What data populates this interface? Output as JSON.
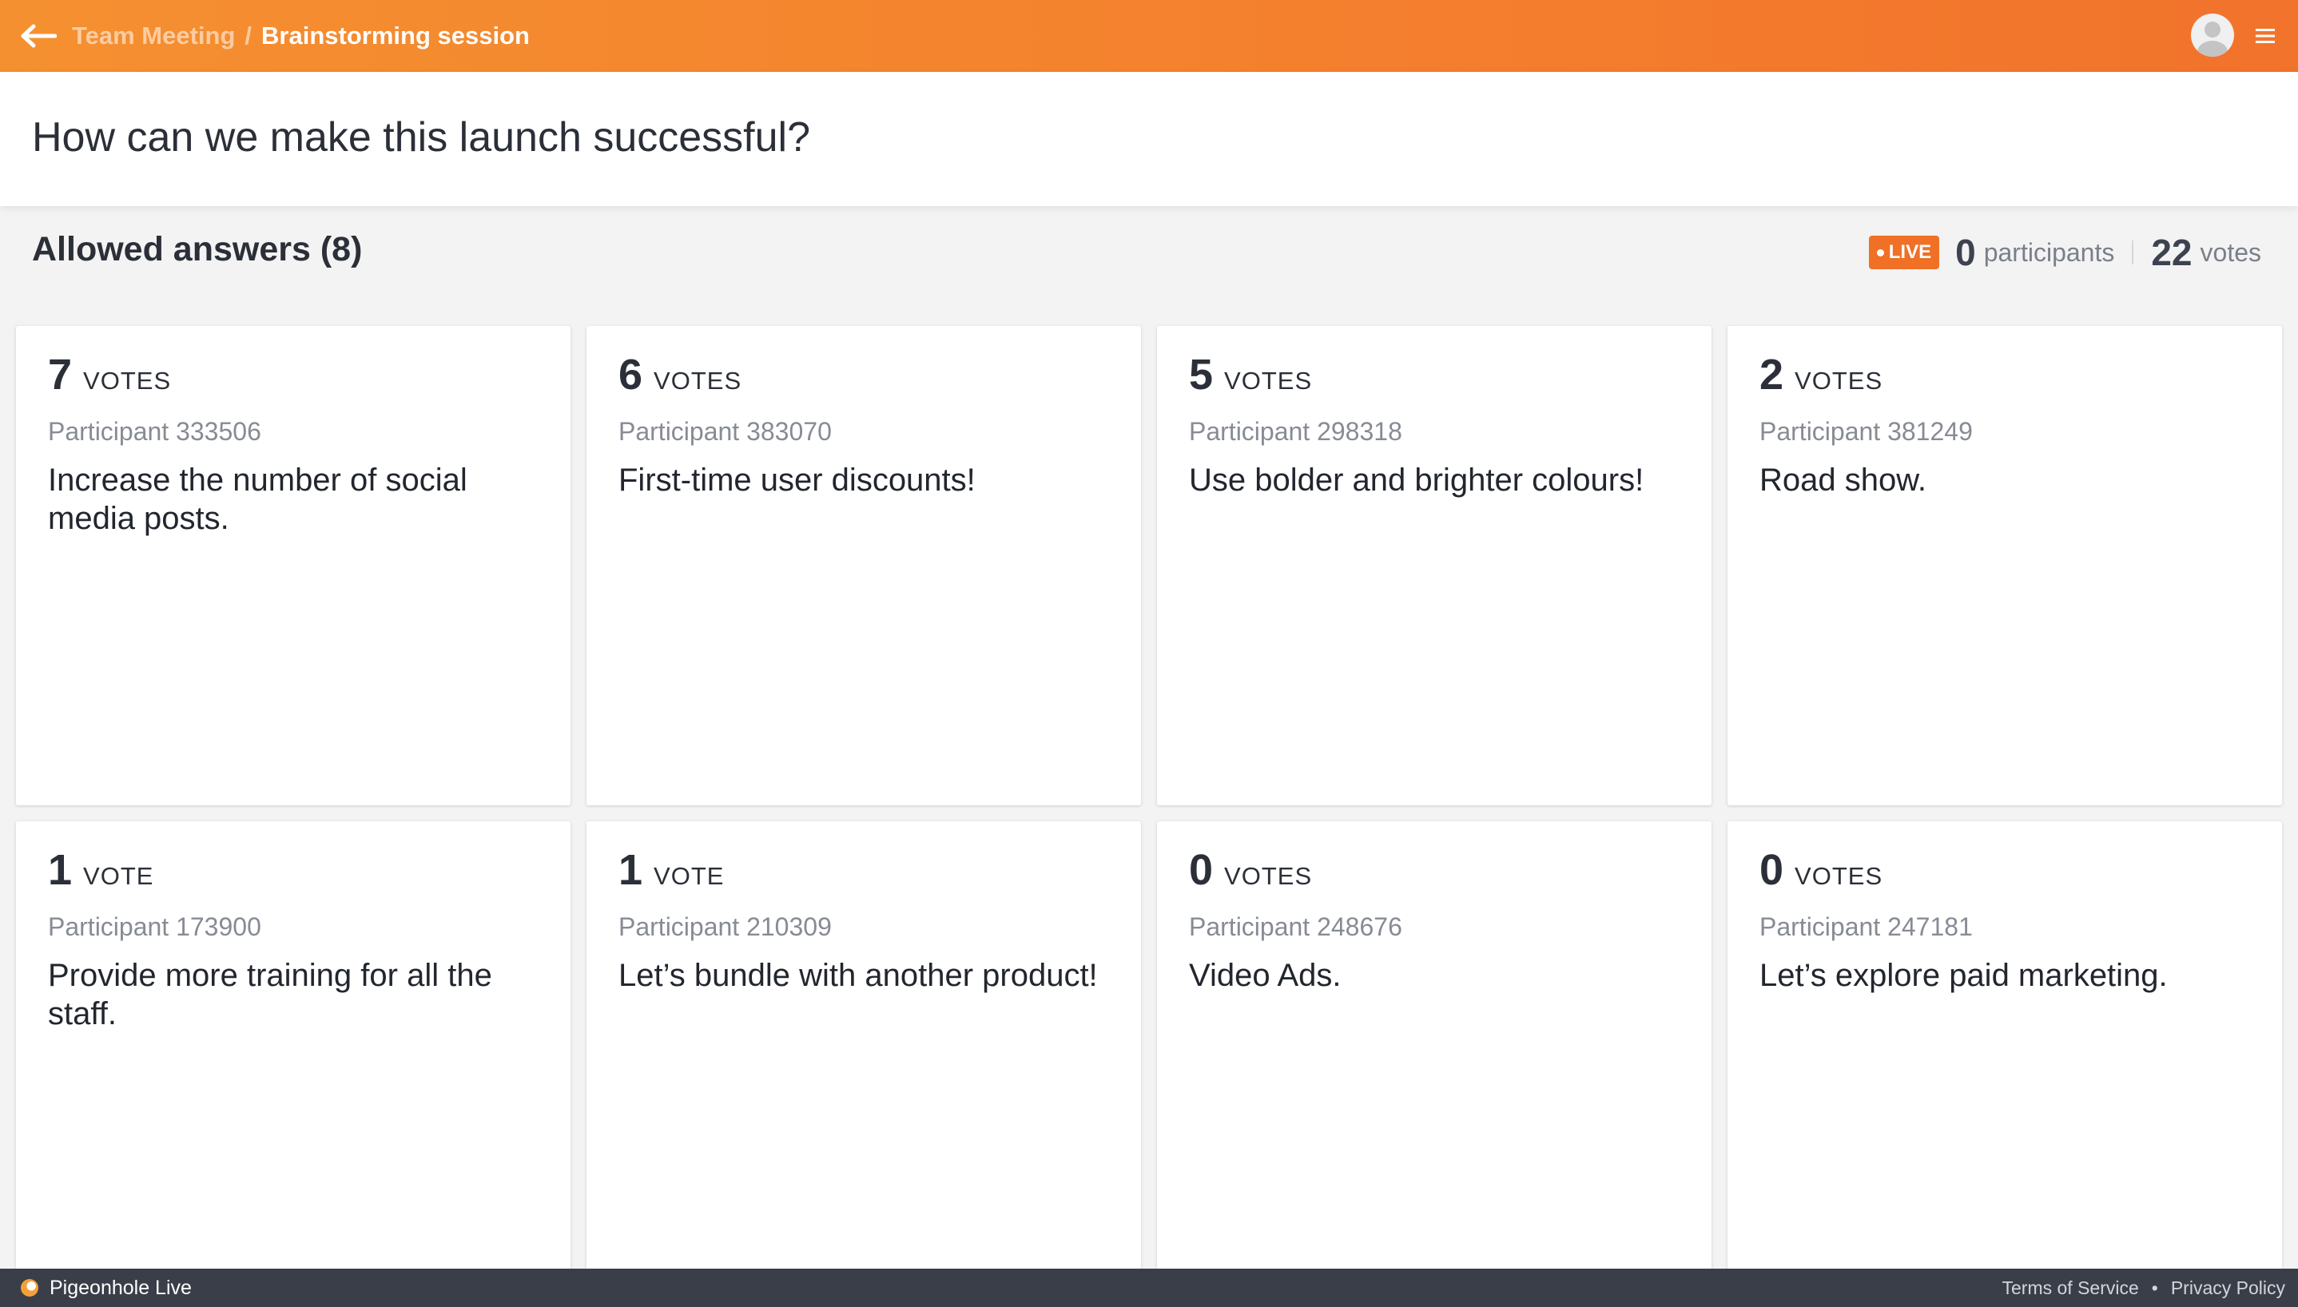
{
  "header": {
    "breadcrumb_parent": "Team Meeting",
    "breadcrumb_separator": "/",
    "breadcrumb_current": "Brainstorming session",
    "back_icon": "arrow-left-icon",
    "avatar_icon": "user-avatar-icon",
    "menu_icon": "hamburger-menu-icon",
    "bar_color": "#f4822e"
  },
  "question": {
    "text": "How can we make this launch successful?"
  },
  "section": {
    "title": "Allowed answers (8)"
  },
  "stats": {
    "live_label": "LIVE",
    "live_color": "#f07026",
    "participants_count": "0",
    "participants_label": "participants",
    "votes_count": "22",
    "votes_label": "votes"
  },
  "answers": [
    {
      "count": "7",
      "unit": "VOTES",
      "participant": "Participant 333506",
      "text": "Increase the number of social media posts."
    },
    {
      "count": "6",
      "unit": "VOTES",
      "participant": "Participant 383070",
      "text": "First-time user discounts!"
    },
    {
      "count": "5",
      "unit": "VOTES",
      "participant": "Participant 298318",
      "text": "Use bolder and brighter colours!"
    },
    {
      "count": "2",
      "unit": "VOTES",
      "participant": "Participant 381249",
      "text": "Road show."
    },
    {
      "count": "1",
      "unit": "VOTE",
      "participant": "Participant 173900",
      "text": "Provide more training for all the staff."
    },
    {
      "count": "1",
      "unit": "VOTE",
      "participant": "Participant 210309",
      "text": "Let’s bundle with another product!"
    },
    {
      "count": "0",
      "unit": "VOTES",
      "participant": "Participant 248676",
      "text": "Video Ads."
    },
    {
      "count": "0",
      "unit": "VOTES",
      "participant": "Participant 247181",
      "text": "Let’s explore paid marketing."
    }
  ],
  "footer": {
    "brand": "Pigeonhole Live",
    "terms": "Terms of Service",
    "separator": "•",
    "privacy": "Privacy Policy"
  }
}
